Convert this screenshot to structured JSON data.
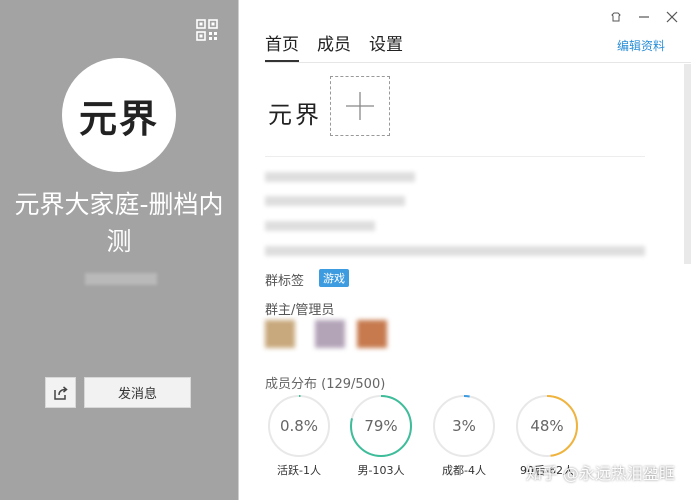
{
  "left": {
    "avatar_text": "元界",
    "group_name": "元界大家庭-删档内测",
    "message_button": "发消息",
    "icons": {
      "qr": "qr-code-icon",
      "share": "share-icon"
    },
    "background_color": "#a3a3a3"
  },
  "right": {
    "tabs": [
      "首页",
      "成员",
      "设置"
    ],
    "active_tab": "首页",
    "edit_link": "编辑资料",
    "logo_text": "元界",
    "add_symbol": "+",
    "tags_label": "群标签",
    "tag": "游戏",
    "admins_label": "群主/管理员",
    "distribution_label": "成员分布 (129/500)",
    "stats": [
      {
        "value": "0.8%",
        "caption": "活跃-1人",
        "fraction": 0.008,
        "color": "#3dbd9a"
      },
      {
        "value": "79%",
        "caption": "男-103人",
        "fraction": 0.79,
        "color": "#3dbd9a"
      },
      {
        "value": "3%",
        "caption": "成都-4人",
        "fraction": 0.03,
        "color": "#3d9be0"
      },
      {
        "value": "48%",
        "caption": "90后-62人",
        "fraction": 0.48,
        "color": "#f0b43c"
      }
    ],
    "watermark": "知乎 @永远热泪盈眶",
    "accent_color": "#2b8fd8"
  }
}
